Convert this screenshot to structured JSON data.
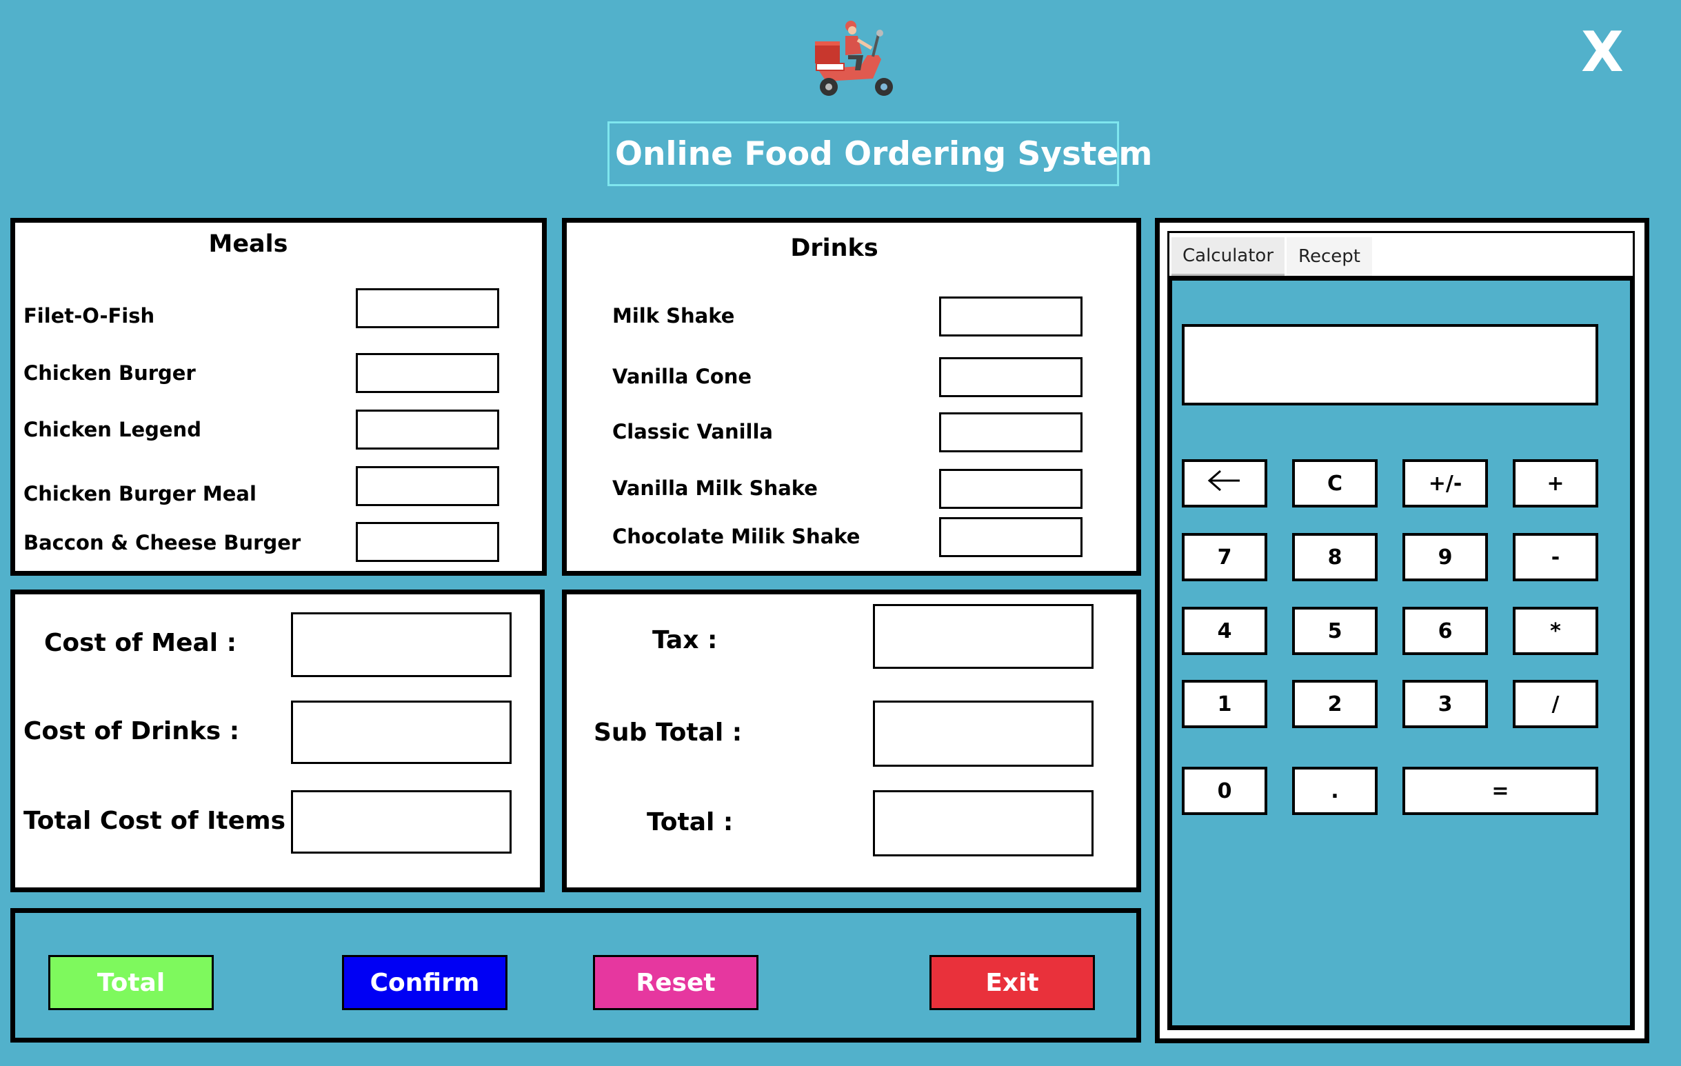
{
  "header": {
    "title": "Online Food Ordering System",
    "close_glyph": "X",
    "logo_icon": "delivery-scooter-icon"
  },
  "meals": {
    "title": "Meals",
    "items": [
      {
        "label": "Filet-O-Fish",
        "value": ""
      },
      {
        "label": "Chicken Burger",
        "value": ""
      },
      {
        "label": "Chicken Legend",
        "value": ""
      },
      {
        "label": "Chicken Burger Meal",
        "value": ""
      },
      {
        "label": "Baccon & Cheese Burger",
        "value": ""
      }
    ]
  },
  "drinks": {
    "title": "Drinks",
    "items": [
      {
        "label": "Milk Shake",
        "value": ""
      },
      {
        "label": "Vanilla Cone",
        "value": ""
      },
      {
        "label": "Classic Vanilla",
        "value": ""
      },
      {
        "label": "Vanilla Milk Shake",
        "value": ""
      },
      {
        "label": "Chocolate Milik Shake",
        "value": ""
      }
    ]
  },
  "costs": {
    "meal_label": "Cost of Meal :",
    "drinks_label": "Cost of Drinks :",
    "items_label": "Total Cost of Items :",
    "meal_value": "",
    "drinks_value": "",
    "items_value": ""
  },
  "totals": {
    "tax_label": "Tax :",
    "subtotal_label": "Sub Total :",
    "total_label": "Total :",
    "tax_value": "",
    "subtotal_value": "",
    "total_value": ""
  },
  "actions": {
    "total": "Total",
    "confirm": "Confirm",
    "reset": "Reset",
    "exit": "Exit"
  },
  "tabs": {
    "calculator": "Calculator",
    "receipt": "Recept",
    "active": "Calculator"
  },
  "calculator": {
    "display": "",
    "backspace_icon": "left-arrow-icon",
    "keys": {
      "clear": "C",
      "negate": "+/-",
      "add": "+",
      "seven": "7",
      "eight": "8",
      "nine": "9",
      "subtract": "-",
      "four": "4",
      "five": "5",
      "six": "6",
      "multiply": "*",
      "one": "1",
      "two": "2",
      "three": "3",
      "divide": "/",
      "zero": "0",
      "decimal": ".",
      "equals": "="
    }
  },
  "colors": {
    "background": "#52b1cb",
    "total_button": "#7ef95d",
    "confirm_button": "#0000f4",
    "reset_button": "#e6379f",
    "exit_button": "#e9313b",
    "title_border": "#7fe6ee"
  }
}
